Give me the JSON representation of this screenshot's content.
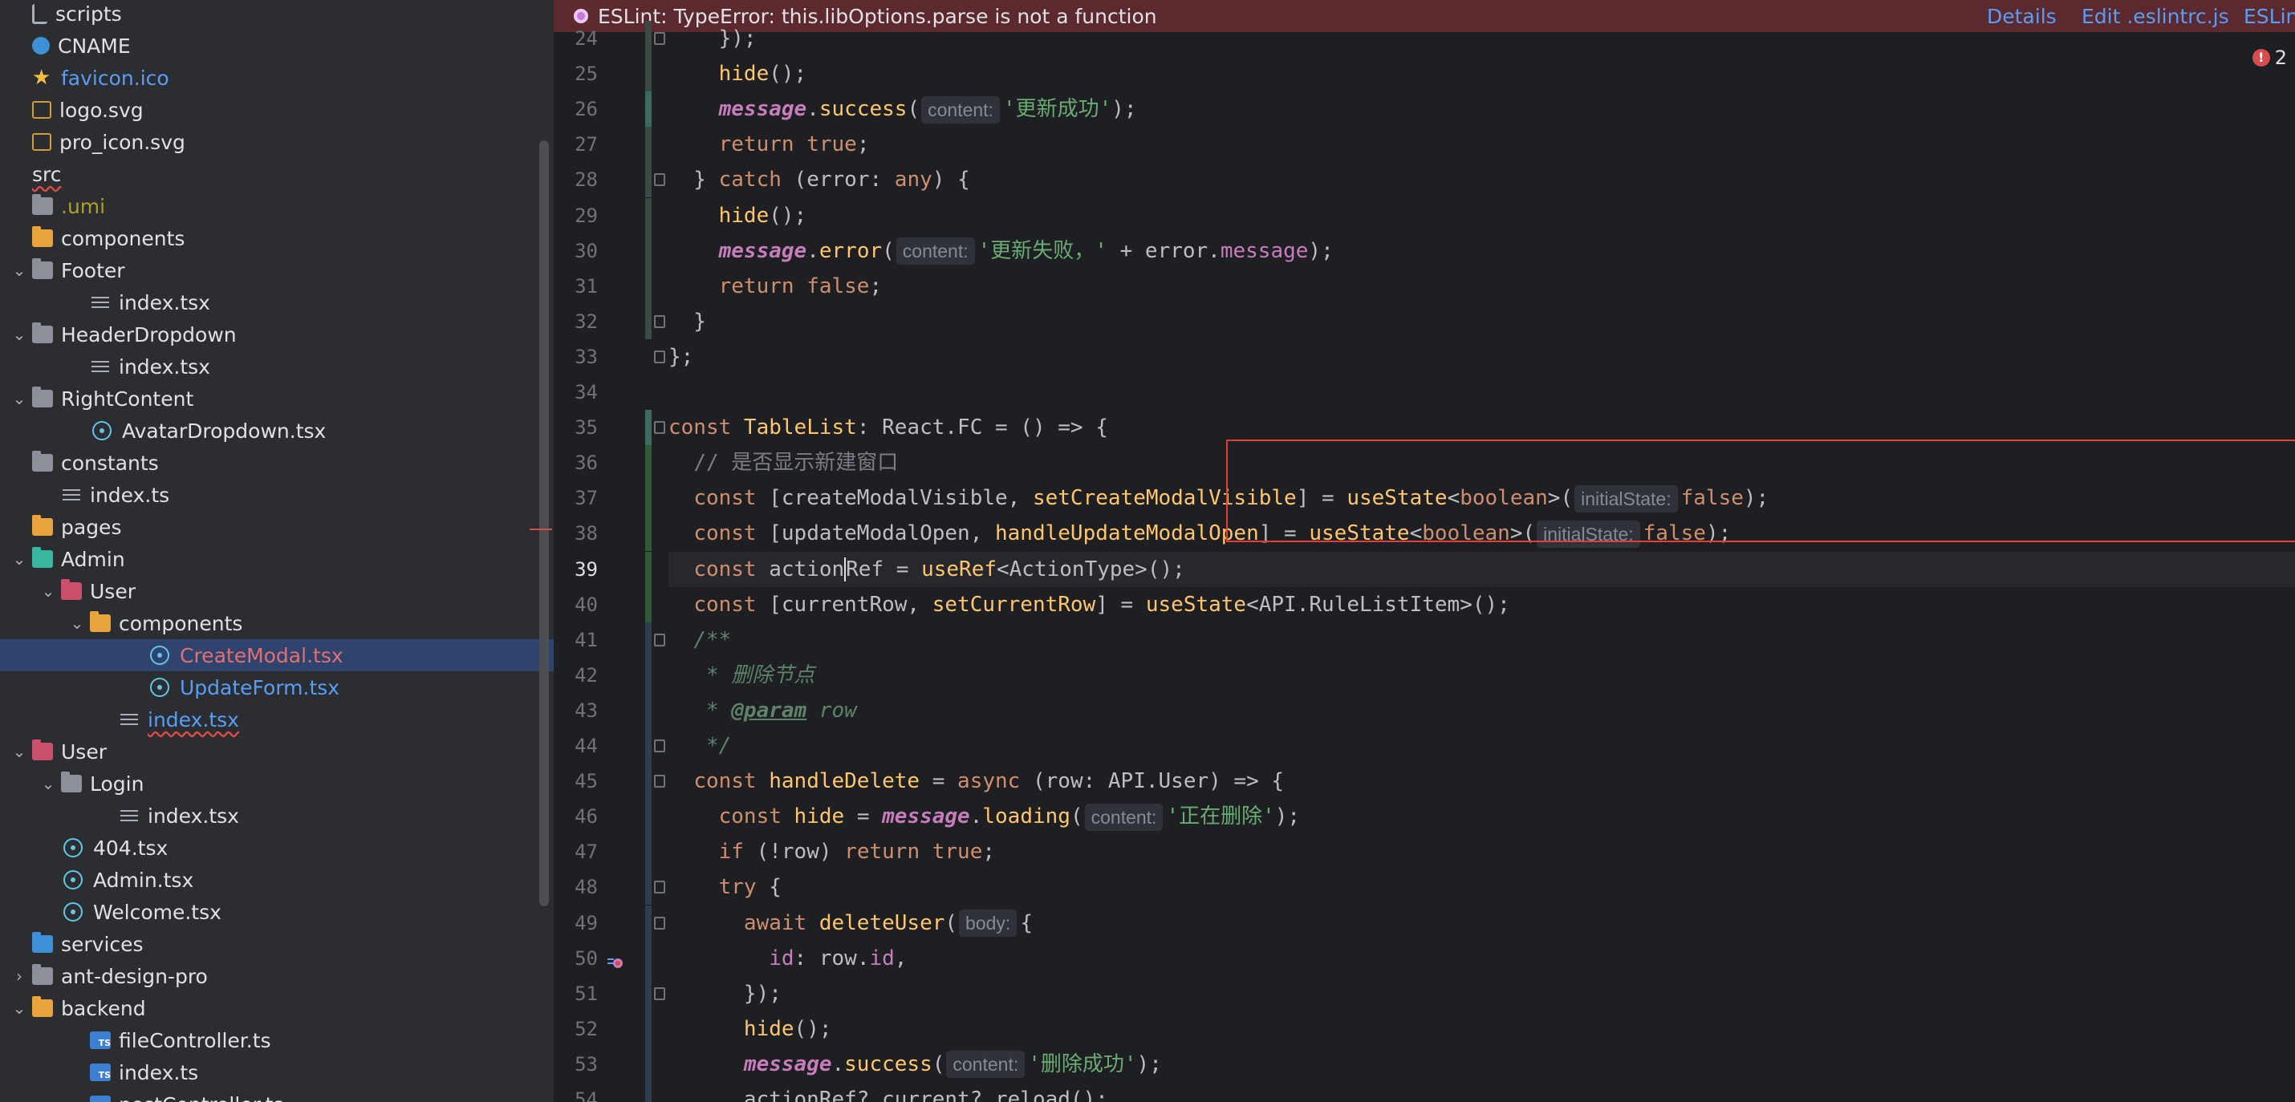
{
  "tree": {
    "items": [
      {
        "label": "scripts",
        "icon": "script-icon",
        "indent": 1,
        "chev": "none",
        "color": "default"
      },
      {
        "label": "CNAME",
        "icon": "globe-icon",
        "indent": 1,
        "chev": "none",
        "color": "default"
      },
      {
        "label": "favicon.ico",
        "icon": "star-icon",
        "indent": 1,
        "chev": "none",
        "color": "blue"
      },
      {
        "label": "logo.svg",
        "icon": "svg-file-icon",
        "indent": 1,
        "chev": "none",
        "color": "default"
      },
      {
        "label": "pro_icon.svg",
        "icon": "svg-file-icon",
        "indent": 1,
        "chev": "none",
        "color": "default"
      },
      {
        "label": "src",
        "icon": "none",
        "indent": 0,
        "chev": "none",
        "color": "default",
        "wavy": true
      },
      {
        "label": ".umi",
        "icon": "folder-icon",
        "indent": 1,
        "chev": "none",
        "color": "olive"
      },
      {
        "label": "components",
        "icon": "folder-orange-icon",
        "indent": 1,
        "chev": "none",
        "color": "default"
      },
      {
        "label": "Footer",
        "icon": "folder-icon",
        "indent": 1,
        "chev": "down",
        "color": "default"
      },
      {
        "label": "index.tsx",
        "icon": "lines-icon",
        "indent": 3,
        "chev": "none",
        "color": "default"
      },
      {
        "label": "HeaderDropdown",
        "icon": "folder-icon",
        "indent": 1,
        "chev": "down",
        "color": "default"
      },
      {
        "label": "index.tsx",
        "icon": "lines-icon",
        "indent": 3,
        "chev": "none",
        "color": "default"
      },
      {
        "label": "RightContent",
        "icon": "folder-icon",
        "indent": 1,
        "chev": "down",
        "color": "default"
      },
      {
        "label": "AvatarDropdown.tsx",
        "icon": "react-icon",
        "indent": 3,
        "chev": "none",
        "color": "default"
      },
      {
        "label": "constants",
        "icon": "folder-icon",
        "indent": 1,
        "chev": "none",
        "color": "default"
      },
      {
        "label": "index.ts",
        "icon": "lines-icon",
        "indent": 2,
        "chev": "none",
        "color": "default"
      },
      {
        "label": "pages",
        "icon": "folder-orange-icon",
        "indent": 1,
        "chev": "none",
        "color": "default"
      },
      {
        "label": "Admin",
        "icon": "folder-teal-icon",
        "indent": 1,
        "chev": "down",
        "color": "default"
      },
      {
        "label": "User",
        "icon": "folder-pink-icon",
        "indent": 2,
        "chev": "down",
        "color": "default"
      },
      {
        "label": "components",
        "icon": "folder-orange-icon",
        "indent": 3,
        "chev": "down",
        "color": "default"
      },
      {
        "label": "CreateModal.tsx",
        "icon": "react-icon",
        "indent": 5,
        "chev": "none",
        "color": "red",
        "selected": true
      },
      {
        "label": "UpdateForm.tsx",
        "icon": "react-icon",
        "indent": 5,
        "chev": "none",
        "color": "blue"
      },
      {
        "label": "index.tsx",
        "icon": "lines-icon",
        "indent": 4,
        "chev": "none",
        "color": "blue",
        "wavy": true
      },
      {
        "label": "User",
        "icon": "folder-pink-icon",
        "indent": 1,
        "chev": "down",
        "color": "default"
      },
      {
        "label": "Login",
        "icon": "folder-icon",
        "indent": 2,
        "chev": "down",
        "color": "default"
      },
      {
        "label": "index.tsx",
        "icon": "lines-icon",
        "indent": 4,
        "chev": "none",
        "color": "default"
      },
      {
        "label": "404.tsx",
        "icon": "react-icon",
        "indent": 2,
        "chev": "none",
        "color": "default"
      },
      {
        "label": "Admin.tsx",
        "icon": "react-icon",
        "indent": 2,
        "chev": "none",
        "color": "default"
      },
      {
        "label": "Welcome.tsx",
        "icon": "react-icon",
        "indent": 2,
        "chev": "none",
        "color": "default"
      },
      {
        "label": "services",
        "icon": "folder-blue-icon",
        "indent": 1,
        "chev": "none",
        "color": "default"
      },
      {
        "label": "ant-design-pro",
        "icon": "folder-icon",
        "indent": 1,
        "chev": "right",
        "color": "default"
      },
      {
        "label": "backend",
        "icon": "folder-orange-icon",
        "indent": 1,
        "chev": "down",
        "color": "default"
      },
      {
        "label": "fileController.ts",
        "icon": "ts-icon",
        "indent": 3,
        "chev": "none",
        "color": "default"
      },
      {
        "label": "index.ts",
        "icon": "ts-icon",
        "indent": 3,
        "chev": "none",
        "color": "default"
      },
      {
        "label": "postController.ts",
        "icon": "ts-icon",
        "indent": 3,
        "chev": "none",
        "color": "default"
      }
    ]
  },
  "banner": {
    "message": "ESLint: TypeError: this.libOptions.parse is not a function",
    "details": "Details",
    "edit": "Edit .eslintrc.js",
    "eslint": "ESLint"
  },
  "problems": {
    "count": "2"
  },
  "editor": {
    "lines": [
      {
        "n": "24",
        "tokens": [
          [
            "p",
            "    });"
          ]
        ]
      },
      {
        "n": "25",
        "tokens": [
          [
            "p",
            "    "
          ],
          [
            "fn",
            "hide"
          ],
          [
            "p",
            "();"
          ]
        ]
      },
      {
        "n": "26",
        "tokens": [
          [
            "p",
            "    "
          ],
          [
            "m",
            "message"
          ],
          [
            "p",
            "."
          ],
          [
            "fn",
            "success"
          ],
          [
            "p",
            "("
          ],
          [
            "hint",
            "content:"
          ],
          [
            "s",
            "'更新成功'"
          ],
          [
            "p",
            ");"
          ]
        ]
      },
      {
        "n": "27",
        "tokens": [
          [
            "p",
            "    "
          ],
          [
            "k",
            "return true"
          ],
          [
            "p",
            ";"
          ]
        ]
      },
      {
        "n": "28",
        "tokens": [
          [
            "p",
            "  } "
          ],
          [
            "k",
            "catch"
          ],
          [
            "p",
            " (error: "
          ],
          [
            "k",
            "any"
          ],
          [
            "p",
            ") {"
          ]
        ]
      },
      {
        "n": "29",
        "tokens": [
          [
            "p",
            "    "
          ],
          [
            "fn",
            "hide"
          ],
          [
            "p",
            "();"
          ]
        ]
      },
      {
        "n": "30",
        "tokens": [
          [
            "p",
            "    "
          ],
          [
            "m",
            "message"
          ],
          [
            "p",
            "."
          ],
          [
            "fn",
            "error"
          ],
          [
            "p",
            "("
          ],
          [
            "hint",
            "content:"
          ],
          [
            "s",
            "'更新失败，'"
          ],
          [
            "p",
            " + error."
          ],
          [
            "v",
            "message"
          ],
          [
            "p",
            ");"
          ]
        ]
      },
      {
        "n": "31",
        "tokens": [
          [
            "p",
            "    "
          ],
          [
            "k",
            "return false"
          ],
          [
            "p",
            ";"
          ]
        ]
      },
      {
        "n": "32",
        "tokens": [
          [
            "p",
            "  }"
          ]
        ]
      },
      {
        "n": "33",
        "tokens": [
          [
            "p",
            "};"
          ]
        ]
      },
      {
        "n": "34",
        "tokens": []
      },
      {
        "n": "35",
        "tokens": [
          [
            "k",
            "const "
          ],
          [
            "fn",
            "TableList"
          ],
          [
            "p",
            ": React.FC = () => {"
          ]
        ]
      },
      {
        "n": "36",
        "tokens": [
          [
            "p",
            "  "
          ],
          [
            "cm",
            "// 是否显示新建窗口"
          ]
        ]
      },
      {
        "n": "37",
        "tokens": [
          [
            "p",
            "  "
          ],
          [
            "k",
            "const "
          ],
          [
            "p",
            "[createModalVisible, "
          ],
          [
            "fn",
            "setCreateModalVisible"
          ],
          [
            "p",
            "] = "
          ],
          [
            "fn",
            "useState"
          ],
          [
            "p",
            "<"
          ],
          [
            "k",
            "boolean"
          ],
          [
            "p",
            ">("
          ],
          [
            "hint",
            "initialState:"
          ],
          [
            "k",
            "false"
          ],
          [
            "p",
            ");"
          ]
        ]
      },
      {
        "n": "38",
        "tokens": [
          [
            "p",
            "  "
          ],
          [
            "k",
            "const "
          ],
          [
            "p",
            "[updateModalOpen, "
          ],
          [
            "fn",
            "handleUpdateModalOpen"
          ],
          [
            "p",
            "] = "
          ],
          [
            "fn",
            "useState"
          ],
          [
            "p",
            "<"
          ],
          [
            "k",
            "boolean"
          ],
          [
            "p",
            ">("
          ],
          [
            "hint",
            "initialState:"
          ],
          [
            "k",
            "false"
          ],
          [
            "p",
            ");"
          ]
        ]
      },
      {
        "n": "39",
        "cur": true,
        "tokens": [
          [
            "p",
            "  "
          ],
          [
            "k",
            "const "
          ],
          [
            "p",
            "action"
          ],
          [
            "caret",
            ""
          ],
          [
            "p",
            "Ref = "
          ],
          [
            "fn",
            "useRef"
          ],
          [
            "p",
            "<ActionType>();"
          ]
        ]
      },
      {
        "n": "40",
        "tokens": [
          [
            "p",
            "  "
          ],
          [
            "k",
            "const "
          ],
          [
            "p",
            "[currentRow, "
          ],
          [
            "fn",
            "setCurrentRow"
          ],
          [
            "p",
            "] = "
          ],
          [
            "fn",
            "useState"
          ],
          [
            "p",
            "<API.RuleListItem>();"
          ]
        ]
      },
      {
        "n": "41",
        "tokens": [
          [
            "p",
            "  "
          ],
          [
            "doc",
            "/**"
          ]
        ]
      },
      {
        "n": "42",
        "tokens": [
          [
            "p",
            "   "
          ],
          [
            "doc",
            "* 删除节点"
          ]
        ]
      },
      {
        "n": "43",
        "tokens": [
          [
            "p",
            "   "
          ],
          [
            "doc",
            "* "
          ],
          [
            "tag",
            "@param"
          ],
          [
            "doc",
            " row"
          ]
        ]
      },
      {
        "n": "44",
        "tokens": [
          [
            "p",
            "   "
          ],
          [
            "doc",
            "*/"
          ]
        ]
      },
      {
        "n": "45",
        "tokens": [
          [
            "p",
            "  "
          ],
          [
            "k",
            "const "
          ],
          [
            "fn",
            "handleDelete"
          ],
          [
            "p",
            " = "
          ],
          [
            "k",
            "async"
          ],
          [
            "p",
            " (row: API.User) => {"
          ]
        ]
      },
      {
        "n": "46",
        "tokens": [
          [
            "p",
            "    "
          ],
          [
            "k",
            "const "
          ],
          [
            "fn",
            "hide"
          ],
          [
            "p",
            " = "
          ],
          [
            "m",
            "message"
          ],
          [
            "p",
            "."
          ],
          [
            "fn",
            "loading"
          ],
          [
            "p",
            "("
          ],
          [
            "hint",
            "content:"
          ],
          [
            "s",
            "'正在删除'"
          ],
          [
            "p",
            ");"
          ]
        ]
      },
      {
        "n": "47",
        "tokens": [
          [
            "p",
            "    "
          ],
          [
            "k",
            "if"
          ],
          [
            "p",
            " (!row) "
          ],
          [
            "k",
            "return true"
          ],
          [
            "p",
            ";"
          ]
        ]
      },
      {
        "n": "48",
        "tokens": [
          [
            "p",
            "    "
          ],
          [
            "k",
            "try"
          ],
          [
            "p",
            " {"
          ]
        ]
      },
      {
        "n": "49",
        "tokens": [
          [
            "p",
            "      "
          ],
          [
            "k",
            "await "
          ],
          [
            "fn",
            "deleteUser"
          ],
          [
            "p",
            "("
          ],
          [
            "hint",
            "body:"
          ],
          [
            "p",
            "{"
          ]
        ]
      },
      {
        "n": "50",
        "tokens": [
          [
            "p",
            "        "
          ],
          [
            "v",
            "id"
          ],
          [
            "p",
            ": row."
          ],
          [
            "v",
            "id"
          ],
          [
            "p",
            ","
          ]
        ]
      },
      {
        "n": "51",
        "tokens": [
          [
            "p",
            "      });"
          ]
        ]
      },
      {
        "n": "52",
        "tokens": [
          [
            "p",
            "      "
          ],
          [
            "fn",
            "hide"
          ],
          [
            "p",
            "();"
          ]
        ]
      },
      {
        "n": "53",
        "tokens": [
          [
            "p",
            "      "
          ],
          [
            "m",
            "message"
          ],
          [
            "p",
            "."
          ],
          [
            "fn",
            "success"
          ],
          [
            "p",
            "("
          ],
          [
            "hint",
            "content:"
          ],
          [
            "s",
            "'删除成功'"
          ],
          [
            "p",
            ");"
          ]
        ]
      },
      {
        "n": "54",
        "tokens": [
          [
            "p",
            "      actionRef?.current?.reload();"
          ]
        ]
      }
    ]
  }
}
